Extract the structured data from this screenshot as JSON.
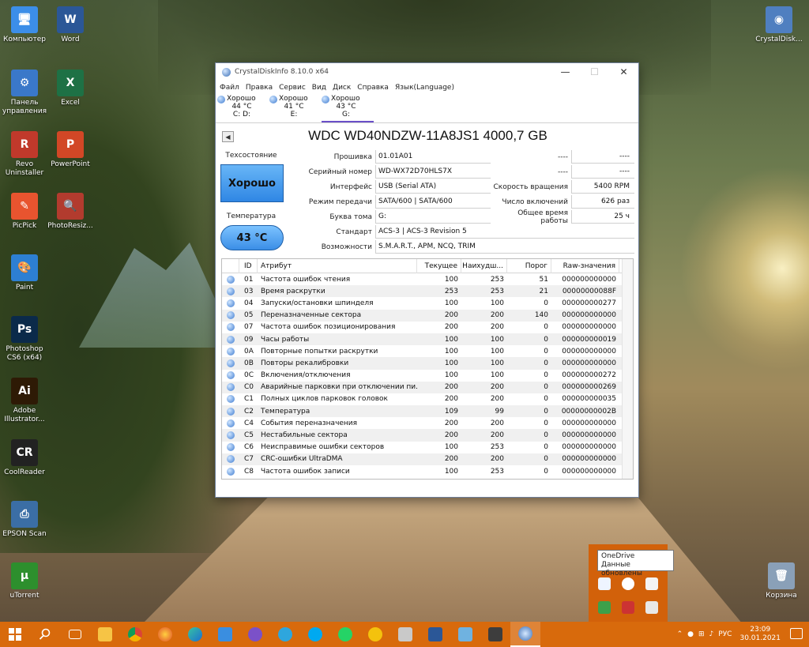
{
  "desktop": {
    "icons": [
      {
        "label": "Компьютер",
        "color": "#3c8ee8",
        "glyph": "🖥"
      },
      {
        "label": "Word",
        "color": "#2b5797",
        "glyph": "W"
      },
      {
        "label": "Панель управления",
        "color": "#3a78c9",
        "glyph": "⚙"
      },
      {
        "label": "Excel",
        "color": "#1e7145",
        "glyph": "X"
      },
      {
        "label": "Revo Uninstaller",
        "color": "#c0392b",
        "glyph": "R"
      },
      {
        "label": "PowerPoint",
        "color": "#d24726",
        "glyph": "P"
      },
      {
        "label": "PicPick",
        "color": "#e8542f",
        "glyph": "✎"
      },
      {
        "label": "PhotoResiz...",
        "color": "#b23b2e",
        "glyph": "🔍"
      },
      {
        "label": "Paint",
        "color": "#2d7fd3",
        "glyph": "🎨"
      },
      {
        "label": "Photoshop CS6 (x64)",
        "color": "#0b2a4a",
        "glyph": "Ps"
      },
      {
        "label": "Adobe Illustrator...",
        "color": "#2e1a05",
        "glyph": "Ai"
      },
      {
        "label": "CoolReader",
        "color": "#222222",
        "glyph": "CR"
      },
      {
        "label": "EPSON Scan",
        "color": "#3b6ea5",
        "glyph": "⎙"
      },
      {
        "label": "uTorrent",
        "color": "#2d8f2d",
        "glyph": "µ"
      },
      {
        "label": "CrystalDisk...",
        "color": "#4f7fc0",
        "glyph": "◉"
      },
      {
        "label": "Корзина",
        "color": "#8aa0b8",
        "glyph": "🗑"
      }
    ]
  },
  "window": {
    "title": "CrystalDiskInfo 8.10.0 x64",
    "minimize": "—",
    "maximize": "☐",
    "close": "✕",
    "menu": [
      "Файл",
      "Правка",
      "Сервис",
      "Вид",
      "Диск",
      "Справка",
      "Язык(Language)"
    ],
    "disks": [
      {
        "status": "Хорошо",
        "temp": "44 °C",
        "letters": "C: D:"
      },
      {
        "status": "Хорошо",
        "temp": "41 °C",
        "letters": "E:"
      },
      {
        "status": "Хорошо",
        "temp": "43 °C",
        "letters": "G:"
      }
    ],
    "disk_title": "WDC WD40NDZW-11A8JS1 4000,7 GB",
    "prev_arrow": "◀",
    "health_label": "Техсостояние",
    "health_value": "Хорошо",
    "temp_label": "Температура",
    "temp_value": "43 °C",
    "fields": {
      "firmware_k": "Прошивка",
      "firmware_v": "01.01A01",
      "serial_k": "Серийный номер",
      "serial_v": "WD-WX72D70HLS7X",
      "interface_k": "Интерфейс",
      "interface_v": "USB (Serial ATA)",
      "transfer_k": "Режим передачи",
      "transfer_v": "SATA/600 | SATA/600",
      "letter_k": "Буква тома",
      "letter_v": "G:",
      "standard_k": "Стандарт",
      "standard_v": "ACS-3 | ACS-3 Revision 5",
      "features_k": "Возможности",
      "features_v": "S.M.A.R.T., APM, NCQ, TRIM",
      "r1_k": "----",
      "r1_v": "----",
      "r2_k": "----",
      "r2_v": "----",
      "rpm_k": "Скорость вращения",
      "rpm_v": "5400 RPM",
      "powercount_k": "Число включений",
      "powercount_v": "626 раз",
      "powerhours_k": "Общее время работы",
      "powerhours_v": "25 ч"
    },
    "table": {
      "headers": [
        "ID",
        "Атрибут",
        "Текущее",
        "Наихудш...",
        "Порог",
        "Raw-значения"
      ],
      "rows": [
        [
          "01",
          "Частота ошибок чтения",
          "100",
          "253",
          "51",
          "000000000000"
        ],
        [
          "03",
          "Время раскрутки",
          "253",
          "253",
          "21",
          "00000000088F"
        ],
        [
          "04",
          "Запуски/остановки шпинделя",
          "100",
          "100",
          "0",
          "000000000277"
        ],
        [
          "05",
          "Переназначенные сектора",
          "200",
          "200",
          "140",
          "000000000000"
        ],
        [
          "07",
          "Частота ошибок позиционирования",
          "200",
          "200",
          "0",
          "000000000000"
        ],
        [
          "09",
          "Часы работы",
          "100",
          "100",
          "0",
          "000000000019"
        ],
        [
          "0A",
          "Повторные попытки раскрутки",
          "100",
          "100",
          "0",
          "000000000000"
        ],
        [
          "0B",
          "Повторы рекалибровки",
          "100",
          "100",
          "0",
          "000000000000"
        ],
        [
          "0C",
          "Включения/отключения",
          "100",
          "100",
          "0",
          "000000000272"
        ],
        [
          "C0",
          "Аварийные парковки при отключении пи...",
          "200",
          "200",
          "0",
          "000000000269"
        ],
        [
          "C1",
          "Полных циклов парковок головок",
          "200",
          "200",
          "0",
          "000000000035"
        ],
        [
          "C2",
          "Температура",
          "109",
          "99",
          "0",
          "00000000002B"
        ],
        [
          "C4",
          "События переназначения",
          "200",
          "200",
          "0",
          "000000000000"
        ],
        [
          "C5",
          "Нестабильные сектора",
          "200",
          "200",
          "0",
          "000000000000"
        ],
        [
          "C6",
          "Неисправимые ошибки секторов",
          "100",
          "253",
          "0",
          "000000000000"
        ],
        [
          "C7",
          "CRC-ошибки UltraDMA",
          "200",
          "200",
          "0",
          "000000000000"
        ],
        [
          "C8",
          "Частота ошибок записи",
          "100",
          "253",
          "0",
          "000000000000"
        ]
      ]
    }
  },
  "tooltip": {
    "line1": "OneDrive",
    "line2": "Данные обновлены"
  },
  "taskbar": {
    "lang": "РУС",
    "time": "23:09",
    "date": "30.01.2021",
    "accent": "#d86a0c"
  }
}
